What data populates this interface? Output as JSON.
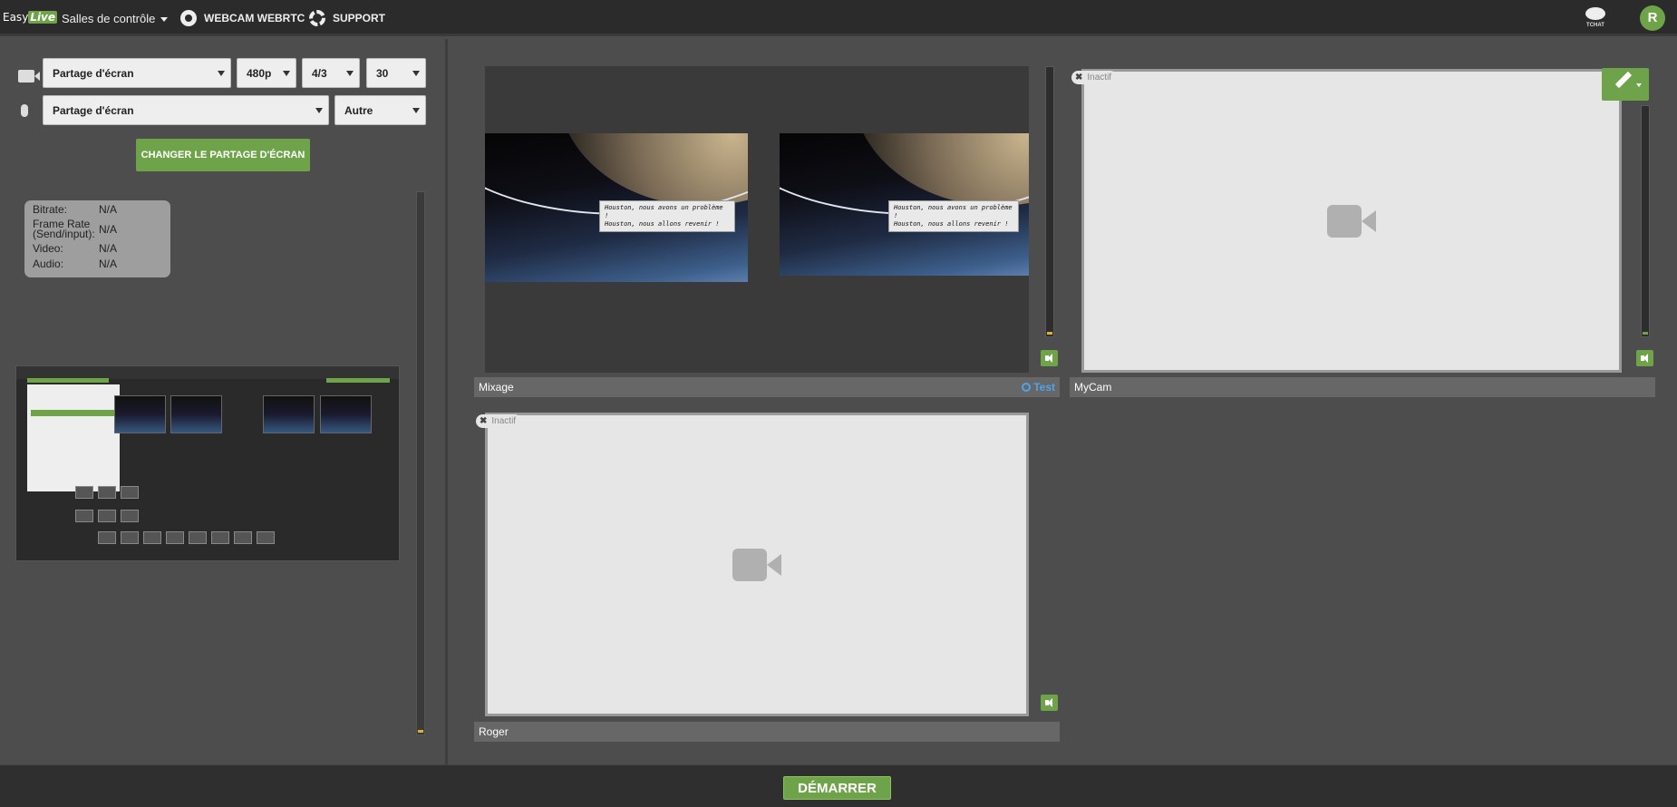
{
  "header": {
    "logo_easy": "Easy",
    "logo_live": "Live",
    "rooms_label": "Salles de contrôle",
    "webcam_label": "WEBCAM WEBRTC",
    "support_label": "SUPPORT",
    "chat_label": "TCHAT",
    "avatar_letter": "R"
  },
  "settings": {
    "video_source": "Partage d'écran",
    "resolution": "480p",
    "ratio": "4/3",
    "fps": "30",
    "audio_source": "Partage d'écran",
    "audio_option": "Autre",
    "change_share_button": "CHANGER LE PARTAGE D'ÉCRAN"
  },
  "stats": {
    "bitrate_label": "Bitrate:",
    "bitrate_value": "N/A",
    "framerate_label_1": "Frame Rate",
    "framerate_label_2": "(Send/input):",
    "framerate_value": "N/A",
    "video_label": "Video:",
    "video_value": "N/A",
    "audio_label": "Audio:",
    "audio_value": "N/A"
  },
  "sources": {
    "mixage": {
      "label": "Mixage",
      "test_label": "Test"
    },
    "mycam": {
      "label": "MyCam",
      "status": "Inactif"
    },
    "roger": {
      "label": "Roger",
      "status": "Inactif"
    }
  },
  "overlay_text": {
    "line1": "Houston, nous avons un problème !",
    "line2": "Houston, nous allons revenir !"
  },
  "footer": {
    "start_button": "DÉMARRER"
  },
  "colors": {
    "accent": "#6fa34a",
    "test_blue": "#4fa3e8",
    "level": "#e0b030"
  }
}
